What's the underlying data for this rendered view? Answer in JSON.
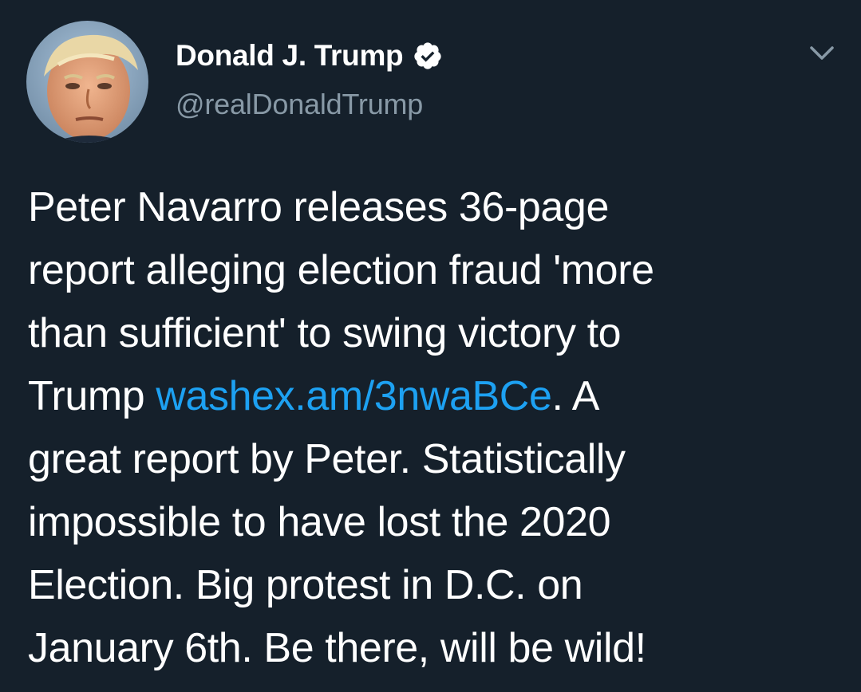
{
  "tweet": {
    "author": {
      "display_name": "Donald J. Trump",
      "handle": "@realDonaldTrump",
      "verified": true,
      "avatar_icon": "profile-photo"
    },
    "menu_icon": "chevron-down-icon",
    "body": {
      "line1": "Peter Navarro releases 36-page",
      "line2": "report alleging election fraud 'more",
      "line3": "than sufficient' to swing victory to",
      "line4_prefix": "Trump ",
      "link_text": "washex.am/3nwaBCe",
      "line4_suffix": ". A",
      "line5": "great report by Peter. Statistically",
      "line6": "impossible to have lost the 2020",
      "line7": "Election. Big protest in D.C. on",
      "line8": "January 6th. Be there, will be wild!"
    }
  },
  "colors": {
    "background": "#15202b",
    "text": "#ffffff",
    "secondary_text": "#8899a6",
    "link": "#1da1f2"
  }
}
